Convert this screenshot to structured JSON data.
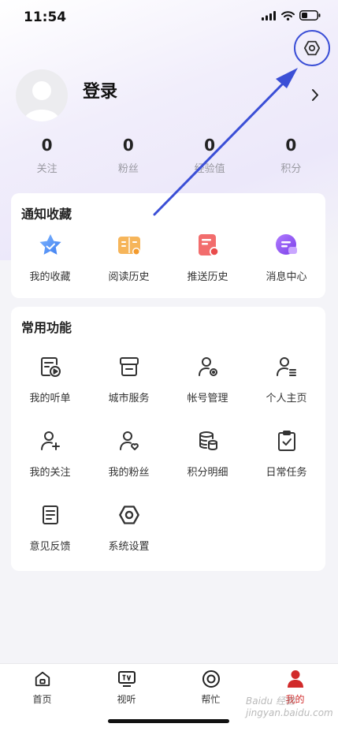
{
  "status_bar": {
    "time": "11:54"
  },
  "profile": {
    "login_label": "登录"
  },
  "stats": [
    {
      "value": "0",
      "label": "关注"
    },
    {
      "value": "0",
      "label": "粉丝"
    },
    {
      "value": "0",
      "label": "经验值"
    },
    {
      "value": "0",
      "label": "积分"
    }
  ],
  "notify_section": {
    "title": "通知收藏",
    "items": [
      {
        "label": "我的收藏",
        "icon": "star-icon"
      },
      {
        "label": "阅读历史",
        "icon": "book-icon"
      },
      {
        "label": "推送历史",
        "icon": "push-history-icon"
      },
      {
        "label": "消息中心",
        "icon": "message-icon"
      }
    ]
  },
  "common_section": {
    "title": "常用功能",
    "items": [
      {
        "label": "我的听单",
        "icon": "playlist-icon"
      },
      {
        "label": "城市服务",
        "icon": "store-icon"
      },
      {
        "label": "帐号管理",
        "icon": "user-gear-icon"
      },
      {
        "label": "个人主页",
        "icon": "user-list-icon"
      },
      {
        "label": "我的关注",
        "icon": "user-plus-icon"
      },
      {
        "label": "我的粉丝",
        "icon": "user-heart-icon"
      },
      {
        "label": "积分明细",
        "icon": "coins-icon"
      },
      {
        "label": "日常任务",
        "icon": "clipboard-check-icon"
      },
      {
        "label": "意见反馈",
        "icon": "feedback-icon"
      },
      {
        "label": "系统设置",
        "icon": "hexagon-settings-icon"
      }
    ]
  },
  "tabbar": [
    {
      "label": "首页",
      "icon": "home-icon"
    },
    {
      "label": "视听",
      "icon": "tv-icon"
    },
    {
      "label": "帮忙",
      "icon": "circle-icon"
    },
    {
      "label": "我的",
      "icon": "person-icon"
    }
  ],
  "colors": {
    "accent": "#d12a2a",
    "annotation": "#3b4fd6"
  },
  "watermark": "Baidu 经验 jingyan.baidu.com"
}
